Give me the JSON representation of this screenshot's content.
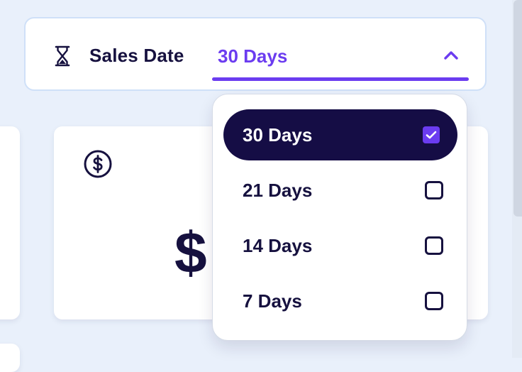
{
  "filter": {
    "label": "Sales Date",
    "selected_value": "30 Days",
    "icon": "hourglass-icon",
    "expanded": true
  },
  "card": {
    "icon": "dollar-circle-icon",
    "value_partial": "$"
  },
  "dropdown": {
    "options": [
      {
        "label": "30 Days",
        "checked": true
      },
      {
        "label": "21 Days",
        "checked": false
      },
      {
        "label": "14 Days",
        "checked": false
      },
      {
        "label": "7 Days",
        "checked": false
      }
    ]
  },
  "colors": {
    "background": "#e9f0fb",
    "primary_dark": "#150d45",
    "accent": "#6b3cf0",
    "panel_border": "#cfe0f8"
  }
}
